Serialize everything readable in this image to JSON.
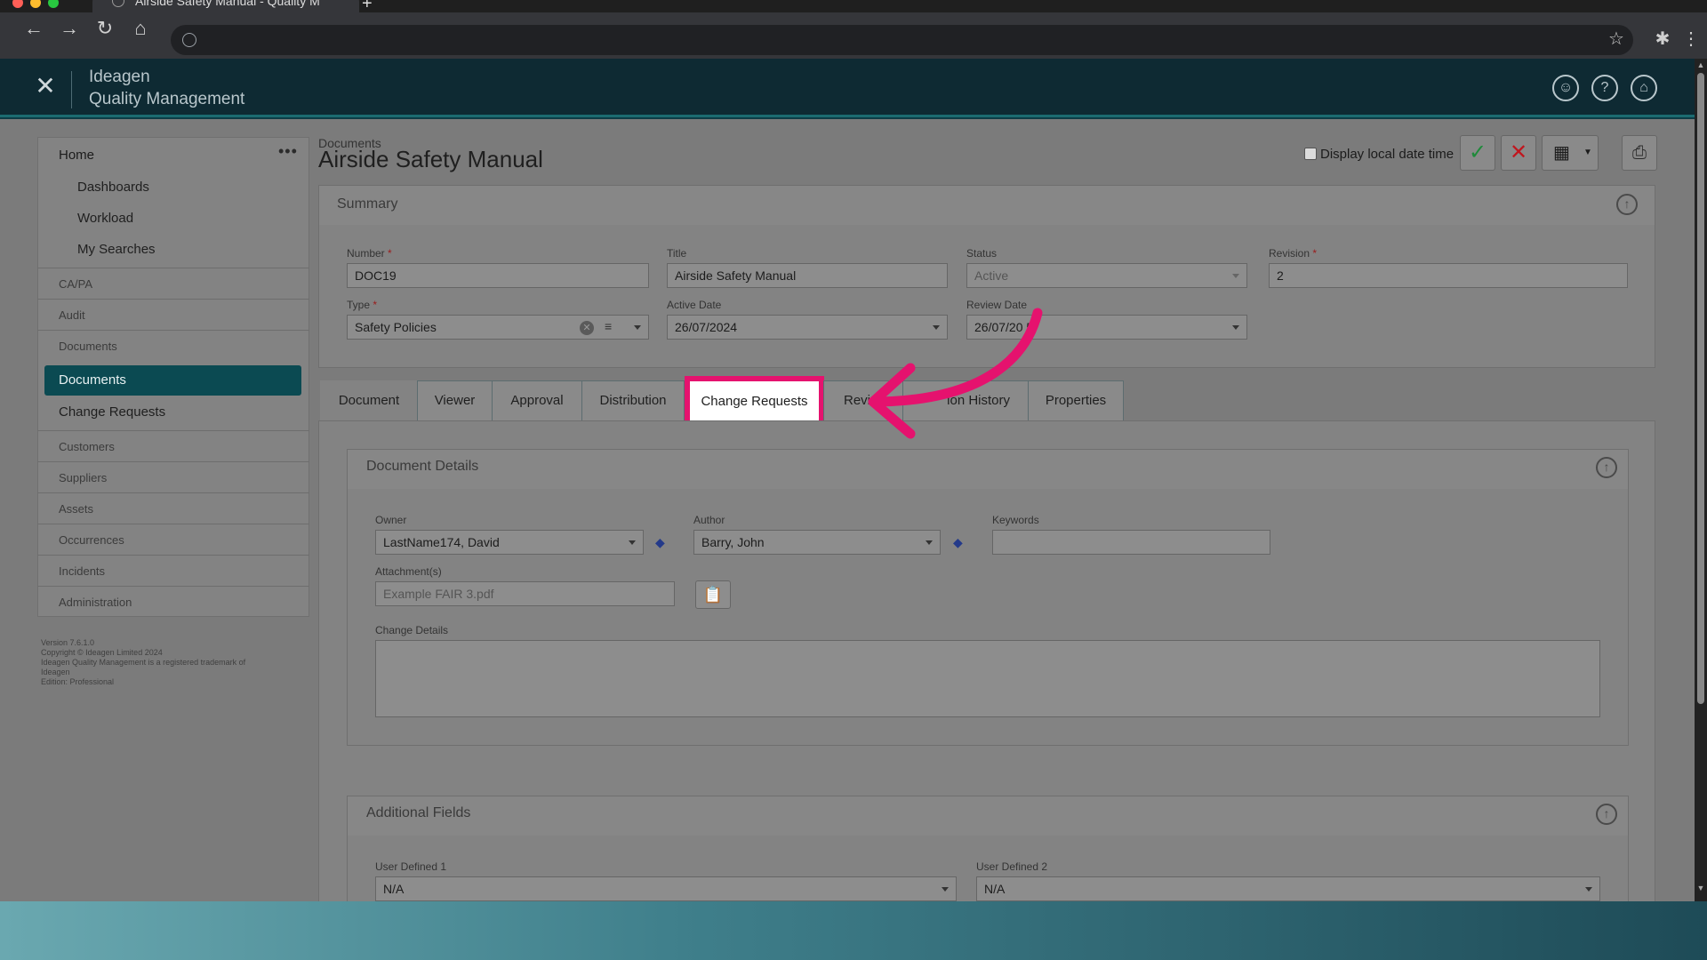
{
  "browser": {
    "tab_title": "Airside Safety Manual - Quality M",
    "new_tab": "+"
  },
  "app": {
    "brand_line1": "Ideagen",
    "brand_line2": "Quality Management"
  },
  "sidebar": {
    "home": "Home",
    "more": "•••",
    "home_items": [
      "Dashboards",
      "Workload",
      "My Searches"
    ],
    "sections": [
      "CA/PA",
      "Audit",
      "Documents"
    ],
    "documents_items": [
      "Documents",
      "Change Requests"
    ],
    "sections2": [
      "Customers",
      "Suppliers",
      "Assets",
      "Occurrences",
      "Incidents",
      "Administration"
    ],
    "footer": {
      "version": "Version 7.6.1.0",
      "copyright": "Copyright © Ideagen Limited 2024",
      "trademark": "Ideagen Quality Management is a registered trademark of",
      "trademark2": "Ideagen",
      "edition": "Edition: Professional"
    }
  },
  "page": {
    "breadcrumb": "Documents",
    "title": "Airside Safety Manual",
    "display_local_label": "Display local date time"
  },
  "summary": {
    "header": "Summary",
    "fields": {
      "number": {
        "label": "Number",
        "value": "DOC19"
      },
      "title": {
        "label": "Title",
        "value": "Airside Safety Manual"
      },
      "status": {
        "label": "Status",
        "value": "Active"
      },
      "revision": {
        "label": "Revision",
        "value": "2"
      },
      "type": {
        "label": "Type",
        "value": "Safety Policies"
      },
      "active_date": {
        "label": "Active Date",
        "value": "26/07/2024"
      },
      "review_date": {
        "label": "Review Date",
        "value": "26/07/20 5"
      }
    }
  },
  "tabs": [
    "Document",
    "Viewer",
    "Approval",
    "Distribution",
    "Change Requests",
    "Revi",
    "ion History",
    "Properties"
  ],
  "document_details": {
    "header": "Document Details",
    "owner": {
      "label": "Owner",
      "value": "LastName174, David"
    },
    "author": {
      "label": "Author",
      "value": "Barry, John"
    },
    "keywords": {
      "label": "Keywords",
      "value": ""
    },
    "attachments": {
      "label": "Attachment(s)",
      "value": "Example FAIR 3.pdf"
    },
    "change_details": {
      "label": "Change Details",
      "value": ""
    }
  },
  "additional_fields": {
    "header": "Additional Fields",
    "user_defined_1": {
      "label": "User Defined 1",
      "value": "N/A"
    },
    "user_defined_2": {
      "label": "User Defined 2",
      "value": "N/A"
    }
  },
  "colors": {
    "header_bg": "#0e2a33",
    "active_nav": "#0b4a52",
    "highlight": "#e5126e",
    "check_green": "#1f8a3a",
    "cross_red": "#c0161e"
  }
}
